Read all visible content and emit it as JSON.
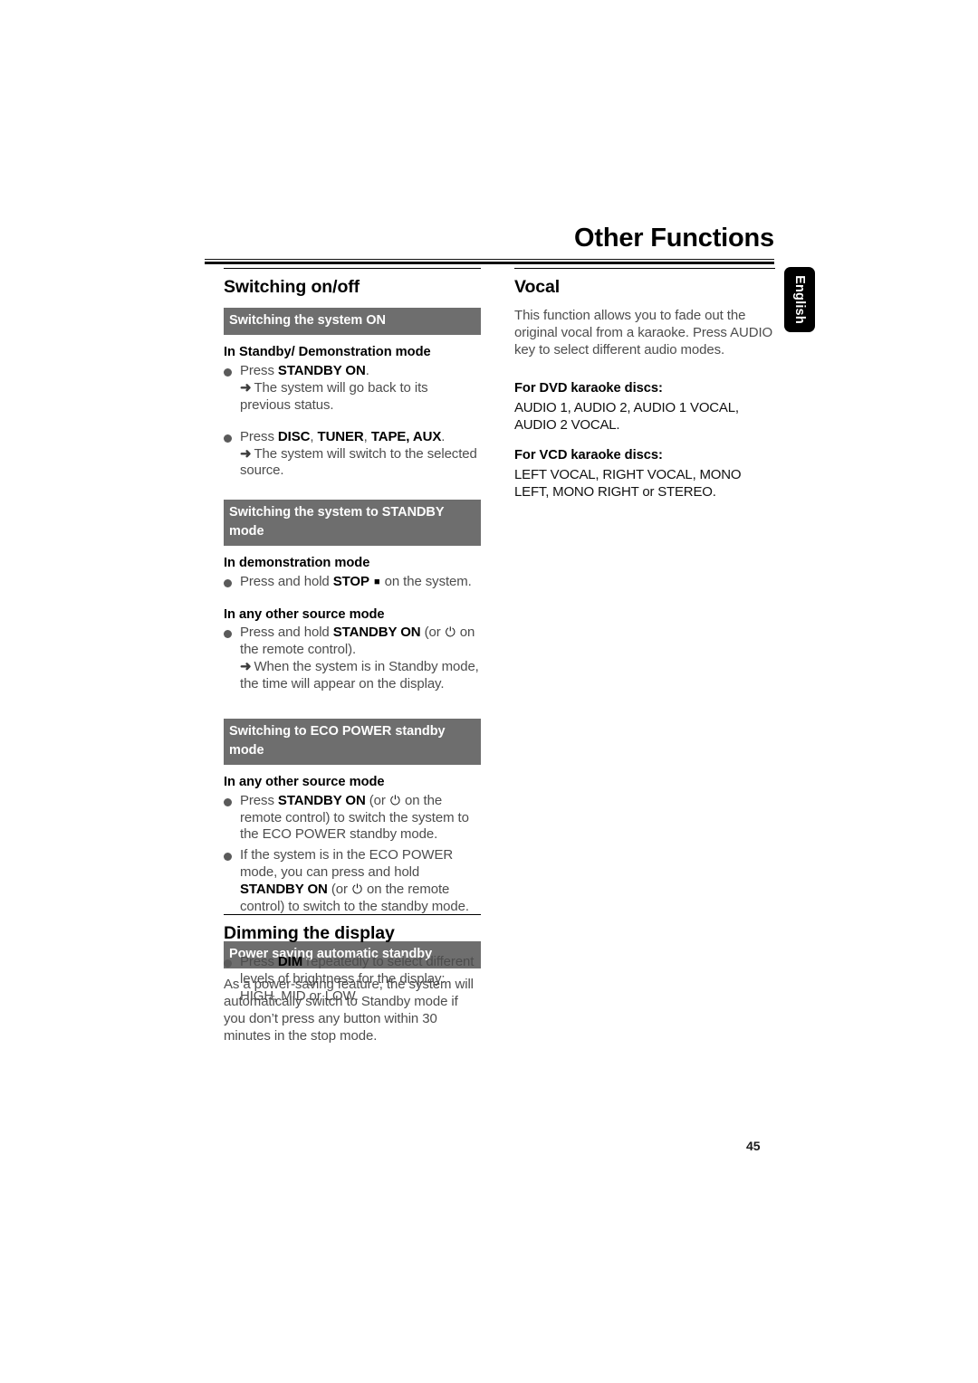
{
  "header": {
    "title": "Other Functions",
    "language_tab": "English"
  },
  "left_column": {
    "section_title": "Switching on/off",
    "blocks": [
      {
        "bar": "Switching the system ON",
        "sub1": "In Standby/ Demonstration mode",
        "item1_prefix": "Press ",
        "item1_bold": "STANDBY ON",
        "item1_suffix": ".",
        "item1_arrow": "The system will go back to its previous status.",
        "item2_prefix": "Press ",
        "item2_bold_a": "DISC",
        "item2_sep_a": ", ",
        "item2_bold_b": "TUNER",
        "item2_sep_b": ", ",
        "item2_bold_c": "TAPE, AUX",
        "item2_suffix": ".",
        "item2_arrow": "The system will switch to the selected source."
      },
      {
        "bar": "Switching the system to STANDBY mode",
        "sub1": "In demonstration mode",
        "item1_prefix": "Press and hold ",
        "item1_bold": "STOP",
        "item1_suffix": " on the system.",
        "sub2": "In any other source mode",
        "item2_prefix": "Press and hold ",
        "item2_bold": "STANDBY ON",
        "item2_suffix": " (or",
        "item2_suffix2": "on the remote control).",
        "item2_arrow": "When the system is in Standby mode, the time will appear on the display."
      },
      {
        "bar": "Switching to ECO POWER standby mode",
        "sub1": "In any other source mode",
        "item1_prefix": "Press ",
        "item1_bold": "STANDBY ON",
        "item1_mid": " (or",
        "item1_suffix": "on the remote control) to switch the system to the ECO POWER standby mode.",
        "item2_prefix": "If the system is in the ECO POWER mode, you can press and hold ",
        "item2_bold": "STANDBY ON",
        "item2_mid": " (or",
        "item2_suffix": "on the remote control) to switch to the standby mode."
      },
      {
        "bar": "Power saving automatic standby",
        "paragraph": "As a power-saving feature, the system will automatically switch to Standby mode if you don’t press any button within 30 minutes in the stop mode."
      }
    ],
    "dimming": {
      "section_title": "Dimming the display",
      "item_prefix": "Press ",
      "item_bold": "DIM",
      "item_suffix": " repeatedly to select different levels of brightness for the display: HIGH, MID or LOW."
    }
  },
  "right_column": {
    "section_title": "Vocal",
    "intro": "This function allows you to fade out the original vocal from a karaoke.   Press AUDIO key to select different audio modes.",
    "dvd_heading": "For DVD karaoke discs:",
    "dvd_modes": "AUDIO 1, AUDIO 2, AUDIO 1 VOCAL, AUDIO 2 VOCAL.",
    "vcd_heading": "For VCD karaoke discs:",
    "vcd_modes": "LEFT VOCAL, RIGHT VOCAL, MONO LEFT, MONO RIGHT or STEREO."
  },
  "footer": {
    "page_number": "45"
  },
  "icons": {
    "power": "⏻",
    "stop": "■",
    "arrow": "➜"
  },
  "colors": {
    "bar_gray": "#6e6e6e",
    "body_text": "#4d4d4d",
    "heading": "#000000"
  }
}
